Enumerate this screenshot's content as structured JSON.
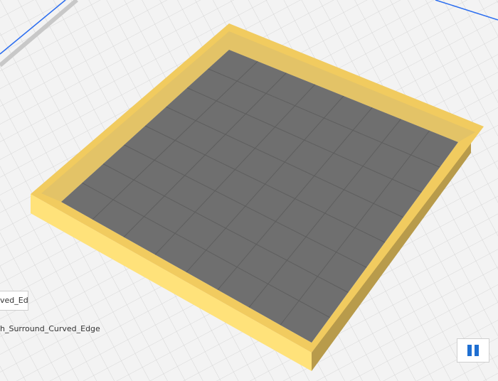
{
  "scene": {
    "bed_color": "#f3f3f3",
    "grid_color": "#cfcfcf",
    "bed_edge_color": "#c8c8c8",
    "build_volume_line_color": "#2a6df0",
    "model_wall_top_color": "#f1cb5f",
    "model_wall_side_light_color": "#ffe27a",
    "model_wall_side_shadow_color": "#b89b4b",
    "model_inner_wall_color": "#e3c367",
    "model_floor_color": "#6f6f6f",
    "model_floor_grid_color": "#5e5e5e"
  },
  "object_panel": {
    "name_field_value": "ved_Ed",
    "model_name": "h_Surround_Curved_Edge"
  },
  "controls": {
    "pause_icon": "pause-icon",
    "pause_color": "#1f6fd1"
  }
}
